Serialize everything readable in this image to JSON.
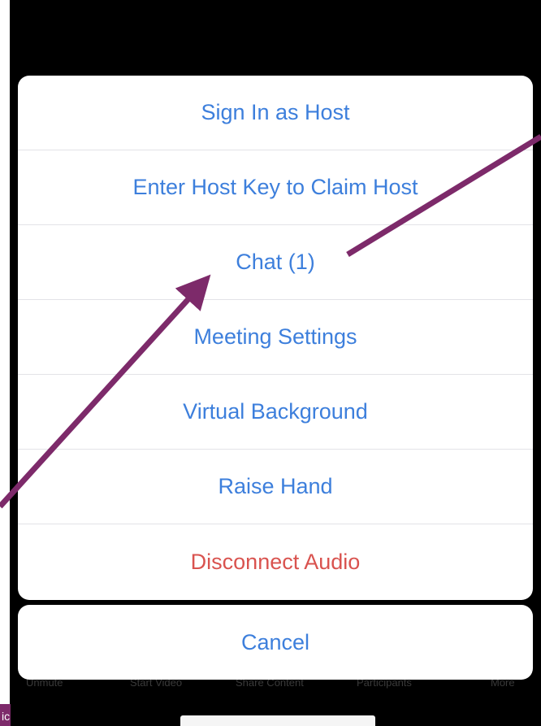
{
  "menu": {
    "items": [
      {
        "label": "Sign In as Host",
        "style": "default"
      },
      {
        "label": "Enter Host Key to Claim Host",
        "style": "default"
      },
      {
        "label": "Chat (1)",
        "style": "default"
      },
      {
        "label": "Meeting Settings",
        "style": "default"
      },
      {
        "label": "Virtual Background",
        "style": "default"
      },
      {
        "label": "Raise Hand",
        "style": "default"
      },
      {
        "label": "Disconnect Audio",
        "style": "destructive"
      }
    ],
    "cancel_label": "Cancel"
  },
  "toolbar": {
    "unmute": "Unmute",
    "start_video": "Start Video",
    "share_content": "Share Content",
    "participants": "Participants",
    "more": "More"
  },
  "tag": {
    "label": "ic"
  },
  "colors": {
    "action_blue": "#3d7fdc",
    "destructive_red": "#d9534f",
    "annotation_arrow": "#7d2a6a",
    "background": "#000000"
  }
}
